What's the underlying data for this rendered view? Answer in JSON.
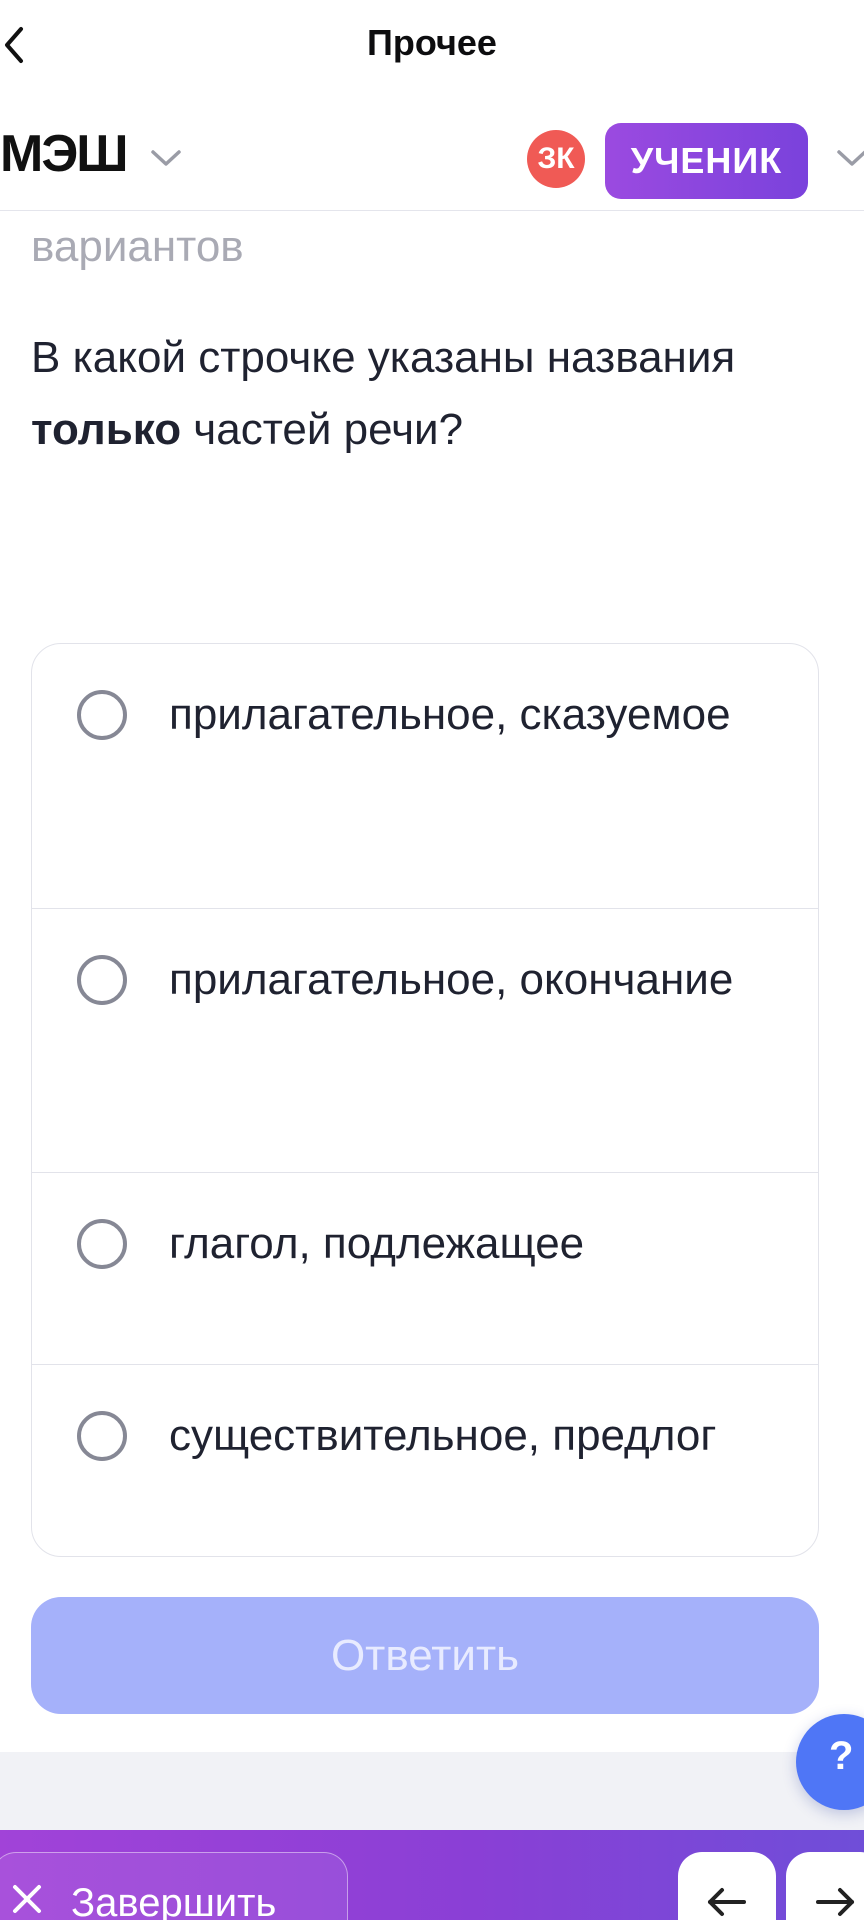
{
  "nav": {
    "title": "Прочее"
  },
  "header": {
    "brand": "МЭШ",
    "avatar_initials": "ЗК",
    "role_label": "УЧЕНИК"
  },
  "content": {
    "faded_text": "вариантов",
    "question": {
      "before": "В какой строчке указаны названия ",
      "bold": "только",
      "after": " частей речи?"
    },
    "options": [
      {
        "label": "прилагательное, сказуемое"
      },
      {
        "label": "прилагательное, окончание"
      },
      {
        "label": "глагол, подлежащее"
      },
      {
        "label": "существительное, предлог"
      }
    ],
    "submit_label": "Ответить",
    "help_label": "?"
  },
  "bottom_bar": {
    "finish_label": "Завершить"
  },
  "colors": {
    "accent": "#8a3fd6",
    "submit_disabled": "#a5b1fa",
    "help": "#4f76f6",
    "avatar": "#f05a55"
  },
  "icons": [
    "chevron-left-icon",
    "chevron-down-icon",
    "close-icon",
    "arrow-left-icon",
    "arrow-right-icon"
  ]
}
